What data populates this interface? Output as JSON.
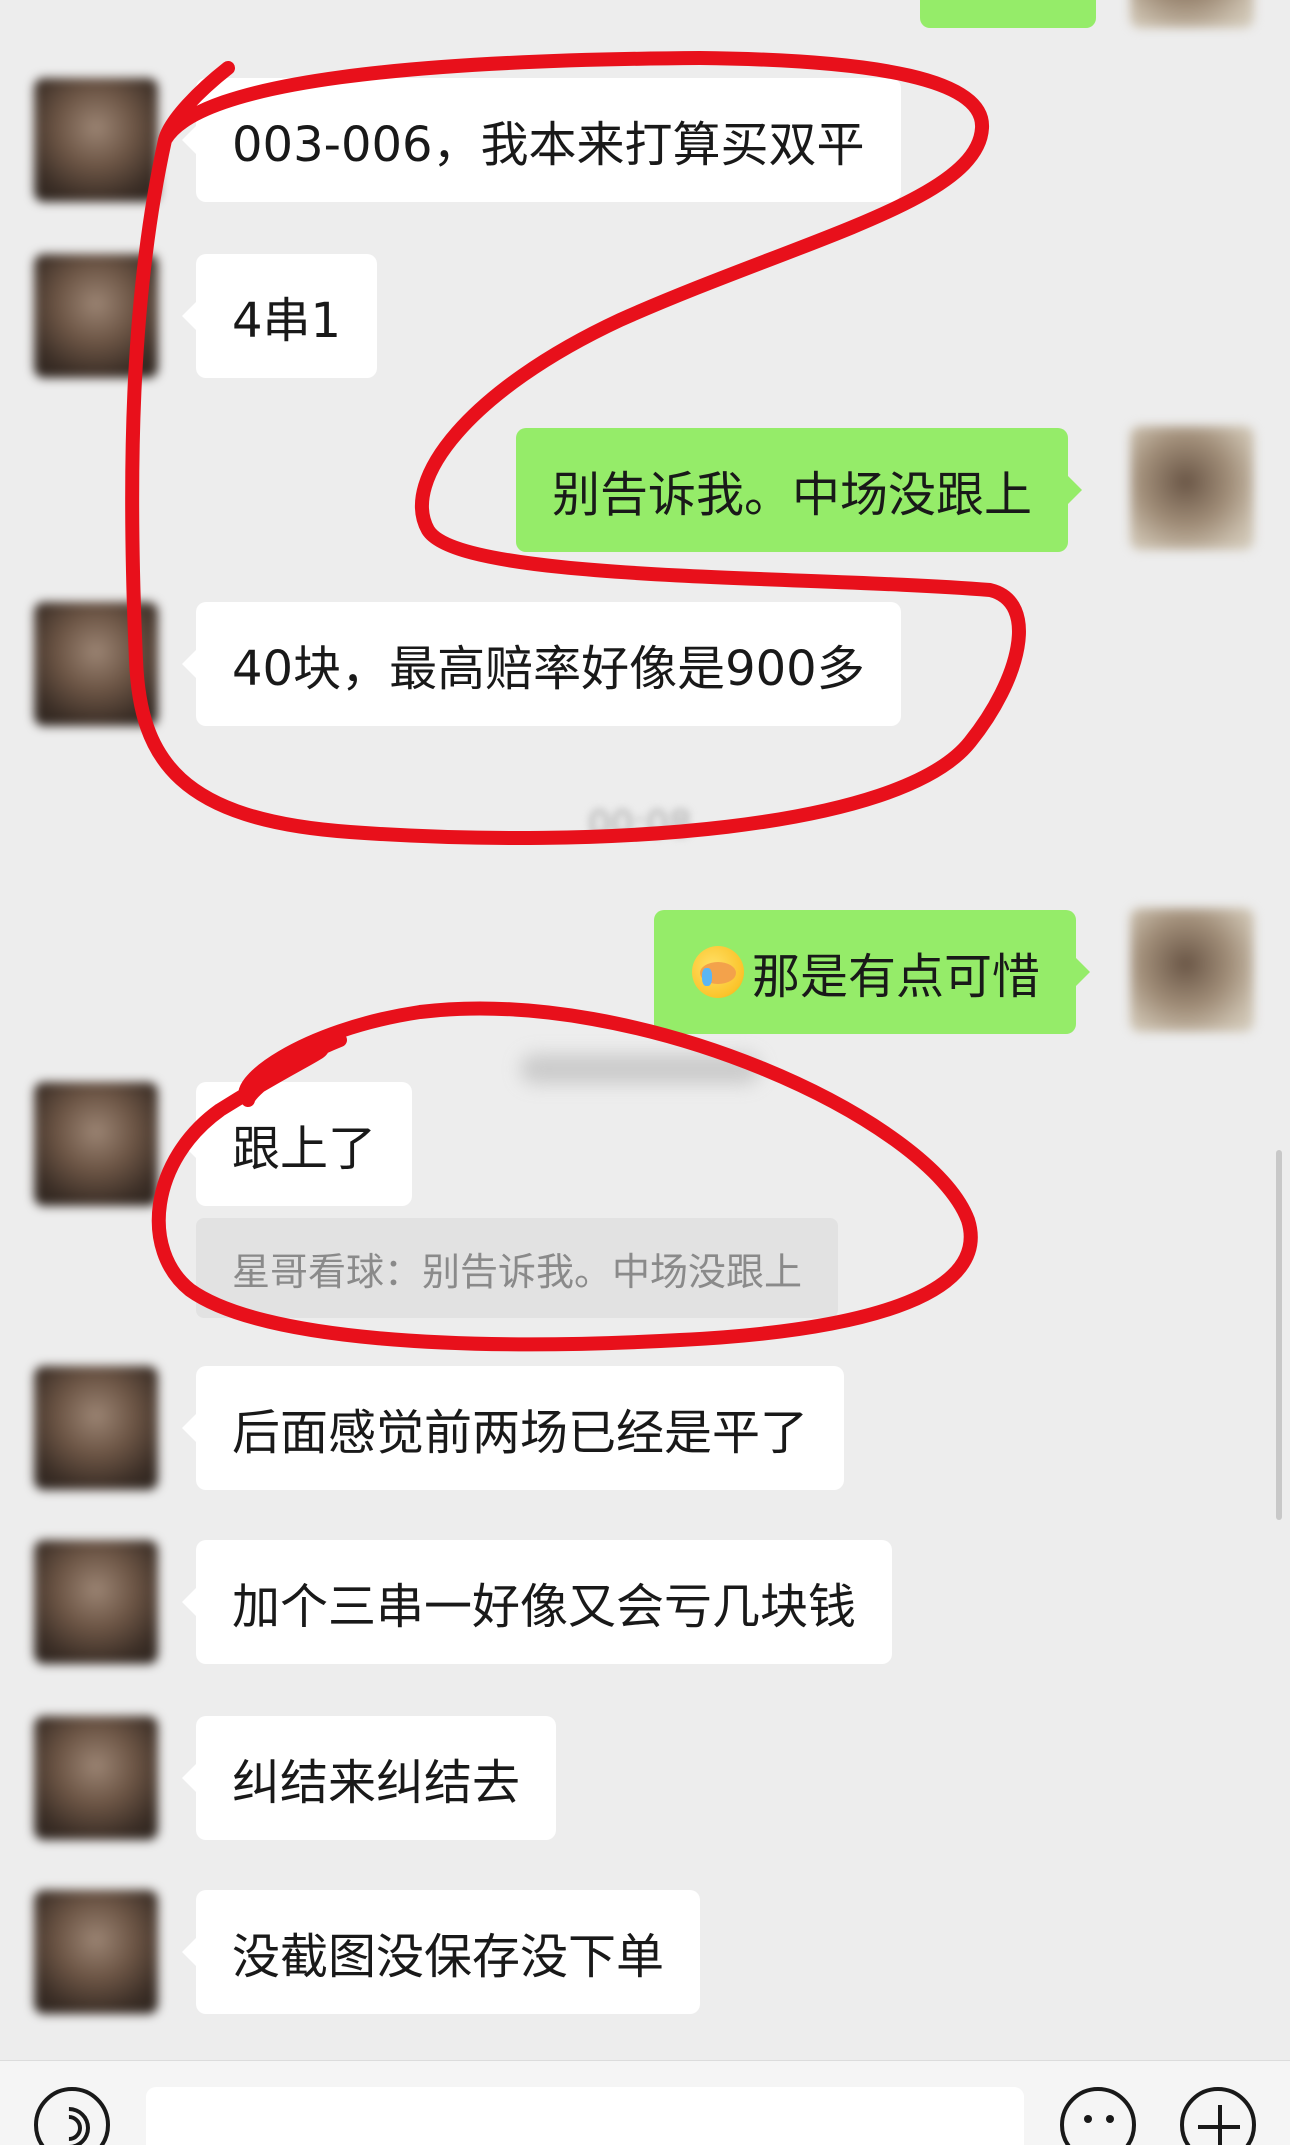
{
  "messages": [
    {
      "side": "in",
      "text": "003-006，我本来打算买双平"
    },
    {
      "side": "in",
      "text": "4串1"
    },
    {
      "side": "out",
      "text": "别告诉我。中场没跟上"
    },
    {
      "side": "in",
      "text": "40块，最高赔率好像是900多"
    },
    {
      "side": "out",
      "text": "那是有点可惜",
      "emoji": "face-with-tears-emoji"
    },
    {
      "side": "in",
      "text": "跟上了"
    },
    {
      "side": "in",
      "text": "后面感觉前两场已经是平了"
    },
    {
      "side": "in",
      "text": "加个三串一好像又会亏几块钱"
    },
    {
      "side": "in",
      "text": "纠结来纠结去"
    },
    {
      "side": "in",
      "text": "没截图没保存没下单"
    }
  ],
  "quote": {
    "text": "星哥看球：别告诉我。中场没跟上"
  },
  "obscured": {
    "timestamp": "00:08"
  },
  "colors": {
    "background": "#ededed",
    "incoming_bubble": "#ffffff",
    "outgoing_bubble": "#95ec69",
    "annotation_stroke": "#e8101b"
  },
  "input_bar": {
    "icons": [
      "voice-icon",
      "emoji-icon",
      "plus-icon"
    ]
  }
}
